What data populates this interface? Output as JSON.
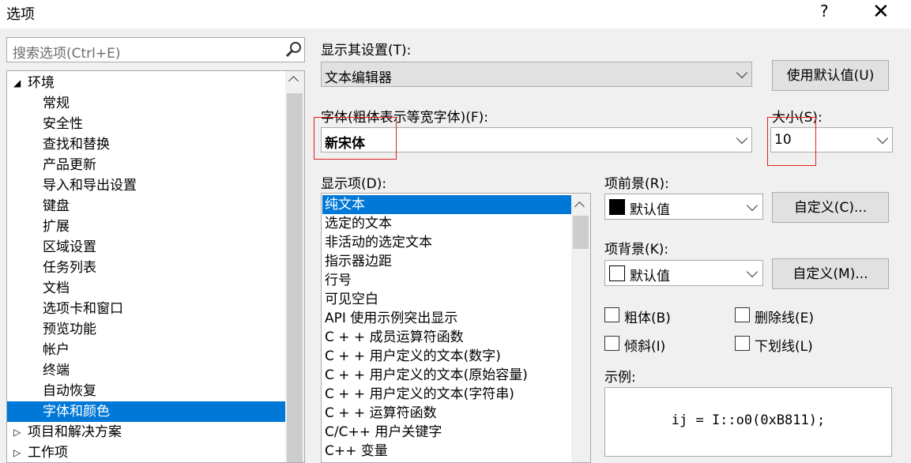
{
  "window": {
    "title": "选项",
    "help": "?",
    "close": "✕"
  },
  "search": {
    "placeholder": "搜索选项(Ctrl+E)"
  },
  "tree": {
    "items": [
      {
        "label": "环境",
        "level": 0,
        "expanded": true
      },
      {
        "label": "常规",
        "level": 1
      },
      {
        "label": "安全性",
        "level": 1
      },
      {
        "label": "查找和替换",
        "level": 1
      },
      {
        "label": "产品更新",
        "level": 1
      },
      {
        "label": "导入和导出设置",
        "level": 1
      },
      {
        "label": "键盘",
        "level": 1
      },
      {
        "label": "扩展",
        "level": 1
      },
      {
        "label": "区域设置",
        "level": 1
      },
      {
        "label": "任务列表",
        "level": 1
      },
      {
        "label": "文档",
        "level": 1
      },
      {
        "label": "选项卡和窗口",
        "level": 1
      },
      {
        "label": "预览功能",
        "level": 1
      },
      {
        "label": "帐户",
        "level": 1
      },
      {
        "label": "终端",
        "level": 1
      },
      {
        "label": "自动恢复",
        "level": 1
      },
      {
        "label": "字体和颜色",
        "level": 1,
        "selected": true
      },
      {
        "label": "项目和解决方案",
        "level": 0,
        "expanded": false
      },
      {
        "label": "工作项",
        "level": 0,
        "expanded": false
      }
    ]
  },
  "settings": {
    "show_settings_label": "显示其设置(T):",
    "show_settings_value": "文本编辑器",
    "use_defaults_button": "使用默认值(U)",
    "font_label": "字体(粗体表示等宽字体)(F):",
    "font_value": "新宋体",
    "size_label": "大小(S):",
    "size_value": "10",
    "display_items_label": "显示项(D):",
    "display_items": [
      "纯文本",
      "选定的文本",
      "非活动的选定文本",
      "指示器边距",
      "行号",
      "可见空白",
      "API 使用示例突出显示",
      "C + + 成员运算符函数",
      "C + + 用户定义的文本(数字)",
      "C + + 用户定义的文本(原始容量)",
      "C + + 用户定义的文本(字符串)",
      "C + + 运算符函数",
      "C/C++ 用户关键字",
      "C++ 变量"
    ],
    "selected_display_item": 0,
    "foreground_label": "项前景(R):",
    "foreground_value": "默认值",
    "foreground_swatch": "#000000",
    "custom_fg_button": "自定义(C)...",
    "background_label": "项背景(K):",
    "background_value": "默认值",
    "background_swatch": "#ffffff",
    "custom_bg_button": "自定义(M)...",
    "bold_label": "粗体(B)",
    "strikethrough_label": "删除线(E)",
    "italic_label": "倾斜(I)",
    "underline_label": "下划线(L)",
    "sample_label": "示例:",
    "sample_text": "ij = I::o0(0xB811);"
  },
  "colors": {
    "selection": "#0078d7",
    "highlight": "#e02020"
  }
}
